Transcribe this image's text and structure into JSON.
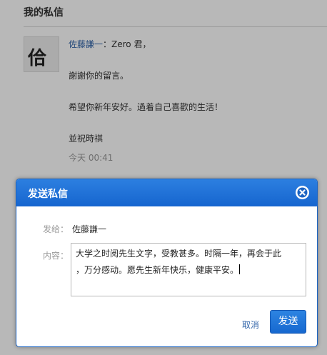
{
  "page": {
    "title": "我的私信"
  },
  "message": {
    "avatar_text": "佮",
    "sender": "佐藤謙一",
    "separator": "：",
    "greeting": "Zero 君，",
    "line1": "謝謝你的留言。",
    "line2": "希望你新年安好。過着自己喜歡的生活！",
    "line3": "並祝時祺",
    "time_label": "今天",
    "time_value": "00:41"
  },
  "dialog": {
    "title": "发送私信",
    "to_label": "发给：",
    "to_value": "佐藤謙一",
    "content_label": "内容：",
    "content_line1": "大学之时阅先生文字，受教甚多。时隔一年，再会于此",
    "content_line2": "，万分感动。愿先生新年快乐，健康平安。",
    "cancel_label": "取消",
    "send_label": "发送"
  },
  "colors": {
    "accent": "#1a6ad4",
    "link": "#3366aa"
  }
}
